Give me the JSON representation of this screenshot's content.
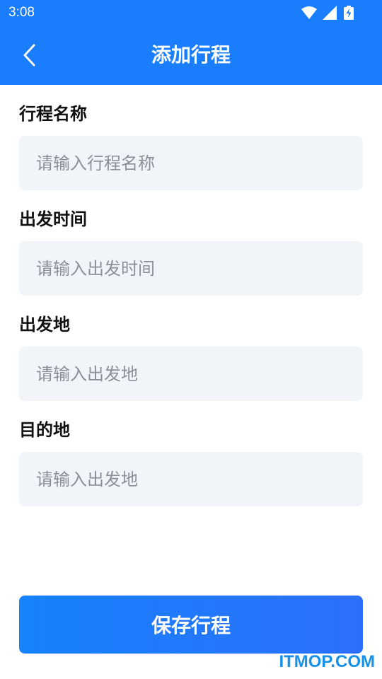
{
  "status_bar": {
    "time": "3:08",
    "icons": [
      "wifi-icon",
      "cellular-signal-icon",
      "battery-charging-icon"
    ]
  },
  "header": {
    "title": "添加行程",
    "back_icon": "chevron-left-icon"
  },
  "colors": {
    "primary": "#1a7dfb",
    "input_background": "#f1f4f8",
    "placeholder": "#8a9099",
    "label": "#111111"
  },
  "form": {
    "fields": [
      {
        "label": "行程名称",
        "placeholder": "请输入行程名称",
        "value": ""
      },
      {
        "label": "出发时间",
        "placeholder": "请输入出发时间",
        "value": ""
      },
      {
        "label": "出发地",
        "placeholder": "请输入出发地",
        "value": ""
      },
      {
        "label": "目的地",
        "placeholder": "请输入出发地",
        "value": ""
      }
    ]
  },
  "actions": {
    "save_label": "保存行程"
  },
  "watermark": "ITMOP.COM"
}
